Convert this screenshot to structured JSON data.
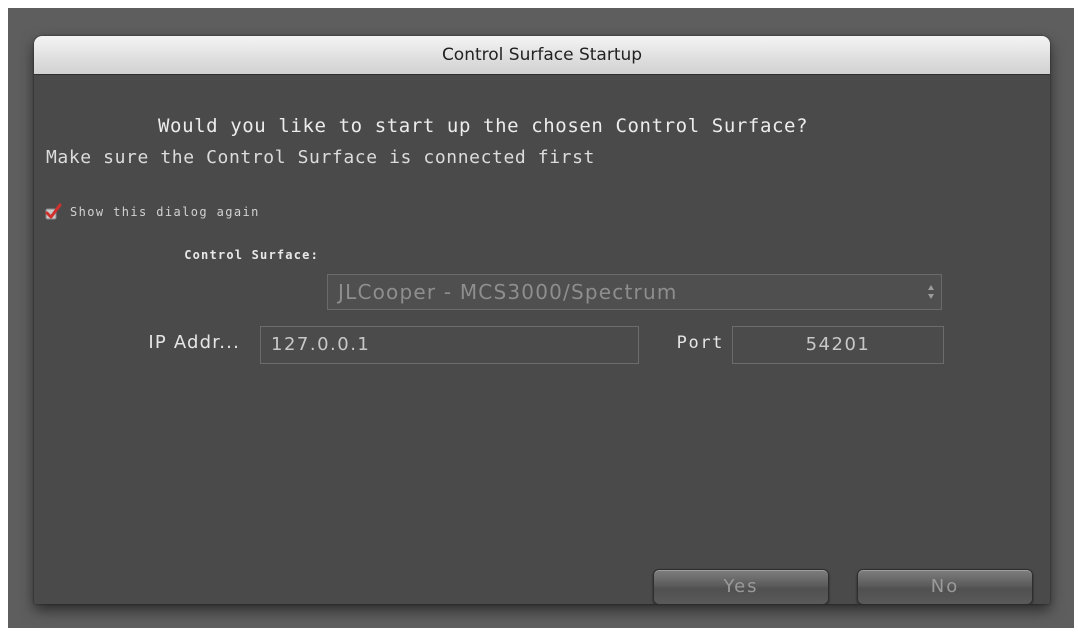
{
  "dialog": {
    "title": "Control Surface Startup",
    "question": "Would you like to start up the chosen Control Surface?",
    "hint": "Make sure the Control Surface is connected first",
    "show_again": {
      "label": "Show this dialog again",
      "checked": true,
      "icon": "checkmark-icon",
      "check_color": "#d0312d"
    },
    "control_surface": {
      "label": "Control Surface:",
      "selected": "JLCooper - MCS3000/Spectrum"
    },
    "ip": {
      "label": "IP Addr...",
      "value": "127.0.0.1"
    },
    "port": {
      "label": "Port",
      "value": "54201"
    },
    "buttons": {
      "yes": "Yes",
      "no": "No"
    }
  },
  "colors": {
    "dialog_background": "#4a4a4a",
    "titlebar": "#dedede",
    "text": "#e4e4e4"
  }
}
